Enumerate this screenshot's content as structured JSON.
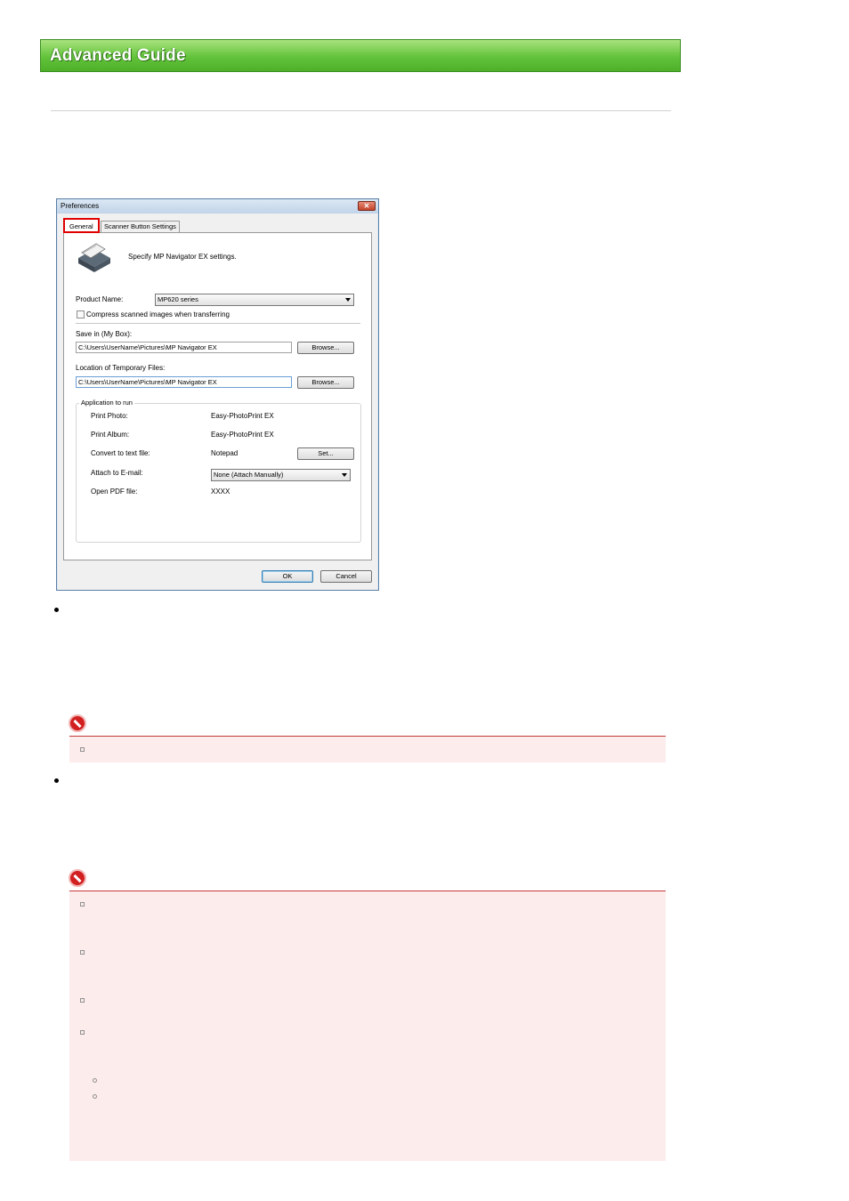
{
  "header": {
    "title": "Advanced Guide"
  },
  "dialog": {
    "title": "Preferences",
    "close_glyph": "✕",
    "tabs": {
      "general": "General",
      "scanner": "Scanner Button Settings"
    },
    "description": "Specify MP Navigator EX settings.",
    "product_name_label": "Product Name:",
    "product_name_value": "MP620 series",
    "compress_label": "Compress scanned images when transferring",
    "save_in_label": "Save in (My Box):",
    "save_in_value": "C:\\Users\\UserName\\Pictures\\MP Navigator EX",
    "temp_files_label": "Location of Temporary Files:",
    "temp_files_value": "C:\\Users\\UserName\\Pictures\\MP Navigator EX",
    "browse_label": "Browse...",
    "apps_group_label": "Application to run",
    "apps": {
      "print_photo_label": "Print Photo:",
      "print_photo_value": "Easy-PhotoPrint EX",
      "print_album_label": "Print Album:",
      "print_album_value": "Easy-PhotoPrint EX",
      "convert_label": "Convert to text file:",
      "convert_value": "Notepad",
      "set_label": "Set...",
      "attach_label": "Attach to E-mail:",
      "attach_value": "None (Attach Manually)",
      "open_pdf_label": "Open PDF file:",
      "open_pdf_value": "XXXX"
    },
    "ok_label": "OK",
    "cancel_label": "Cancel"
  }
}
